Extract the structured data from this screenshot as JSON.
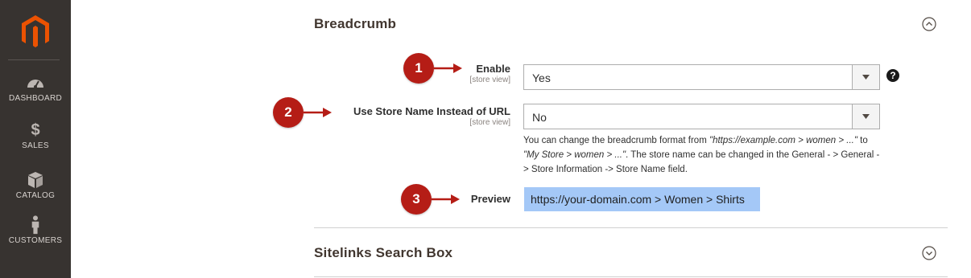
{
  "sidebar": {
    "items": [
      {
        "label": "DASHBOARD",
        "icon": "dashboard-gauge-icon"
      },
      {
        "label": "SALES",
        "icon": "dollar-icon"
      },
      {
        "label": "CATALOG",
        "icon": "box-icon"
      },
      {
        "label": "CUSTOMERS",
        "icon": "person-icon"
      }
    ],
    "logo": "magento-logo"
  },
  "breadcrumb_section": {
    "title": "Breadcrumb",
    "toggle_icon": "collapse-chevron-up-icon",
    "fields": {
      "enable": {
        "label": "Enable",
        "scope": "[store view]",
        "value": "Yes"
      },
      "use_store_name": {
        "label": "Use Store Name Instead of URL",
        "scope": "[store view]",
        "value": "No"
      },
      "preview": {
        "label": "Preview",
        "value": "https://your-domain.com > Women > Shirts"
      }
    },
    "note": {
      "part1": "You can change the breadcrumb format from ",
      "example1": "\"https://example.com > women > ...\"",
      "part2": " to ",
      "example2": "\"My Store > women > ...\"",
      "part3": ". The store name can be changed in the General - > General -> Store Information -> Store Name field."
    },
    "help_icon": "?"
  },
  "sitelinks_section": {
    "title": "Sitelinks Search Box",
    "toggle_icon": "expand-chevron-down-icon"
  },
  "callouts": [
    "1",
    "2",
    "3"
  ],
  "colors": {
    "sidebar_bg": "#373330",
    "accent_orange": "#eb5202",
    "callout_red": "#b51d16",
    "preview_bg": "#a4c8f7"
  }
}
